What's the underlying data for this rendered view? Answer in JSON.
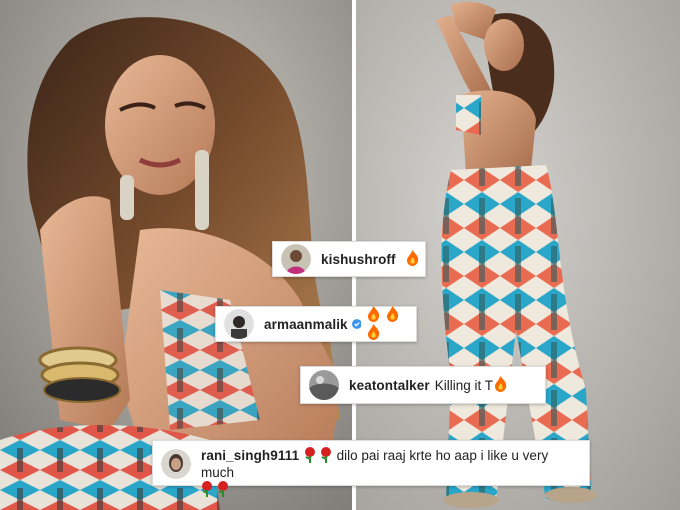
{
  "images": {
    "left_photo_icon": "portrait-photo",
    "right_photo_icon": "full-length-photo"
  },
  "comments": [
    {
      "username": "kishushroff",
      "verified": true,
      "text": "",
      "emoji": "🔥"
    },
    {
      "username": "armaanmalik",
      "verified": true,
      "text": "",
      "emoji": "🔥🔥🔥"
    },
    {
      "username": "keatontalker",
      "verified": false,
      "text": "Killing it T",
      "emoji": "🔥"
    },
    {
      "username": "rani_singh9111",
      "verified": false,
      "text": "dilo pai raaj krte ho aap i like u very much",
      "emoji": "🌹🌹"
    }
  ],
  "colors": {
    "verified_blue": "#3897f0",
    "fire": "#ff6a00",
    "rose": "#d62020"
  }
}
